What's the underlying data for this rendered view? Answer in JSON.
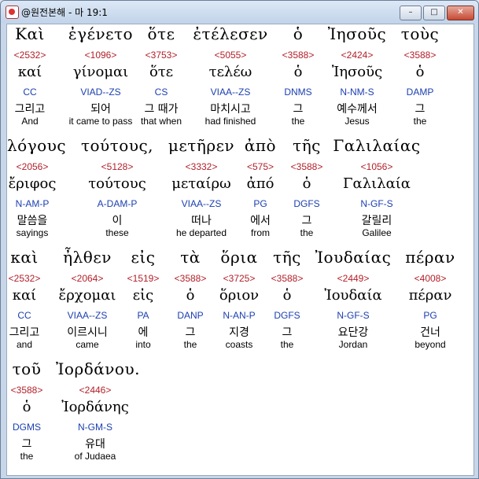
{
  "window": {
    "title": "@원전본해 - 마 19:1",
    "buttons": {
      "minimize": "–",
      "maximize": "□",
      "close": "✕"
    }
  },
  "rows": [
    [
      {
        "greek": "Καὶ",
        "strong": "<2532>",
        "lemma": "καί",
        "parse": "CC",
        "korean": "그리고",
        "english": "And"
      },
      {
        "greek": "ἐγένετο",
        "strong": "<1096>",
        "lemma": "γίνομαι",
        "parse": "VIAD--ZS",
        "korean": "되어",
        "english": "it came to pass"
      },
      {
        "greek": "ὅτε",
        "strong": "<3753>",
        "lemma": "ὅτε",
        "parse": "CS",
        "korean": "그 때가",
        "english": "that when"
      },
      {
        "greek": "ἐτέλεσεν",
        "strong": "<5055>",
        "lemma": "τελέω",
        "parse": "VIAA--ZS",
        "korean": "마치시고",
        "english": "had finished"
      },
      {
        "greek": "ὁ",
        "strong": "<3588>",
        "lemma": "ὁ",
        "parse": "DNMS",
        "korean": "그",
        "english": "the"
      },
      {
        "greek": "Ἰησοῦς",
        "strong": "<2424>",
        "lemma": "Ἰησοῦς",
        "parse": "N-NM-S",
        "korean": "예수께서",
        "english": "Jesus"
      },
      {
        "greek": "τοὺς",
        "strong": "<3588>",
        "lemma": "ὁ",
        "parse": "DAMP",
        "korean": "그",
        "english": "the"
      }
    ],
    [
      {
        "greek": "λόγους",
        "strong": "<2056>",
        "lemma": "ἔριφος",
        "parse": "N-AM-P",
        "korean": "말씀을",
        "english": "sayings"
      },
      {
        "greek": "τούτους,",
        "strong": "<5128>",
        "lemma": "τούτους",
        "parse": "A-DAM-P",
        "korean": "이",
        "english": "these"
      },
      {
        "greek": "μετῆρεν",
        "strong": "<3332>",
        "lemma": "μεταίρω",
        "parse": "VIAA--ZS",
        "korean": "떠나",
        "english": "he departed"
      },
      {
        "greek": "ἀπὸ",
        "strong": "<575>",
        "lemma": "ἀπό",
        "parse": "PG",
        "korean": "에서",
        "english": "from"
      },
      {
        "greek": "τῆς",
        "strong": "<3588>",
        "lemma": "ὁ",
        "parse": "DGFS",
        "korean": "그",
        "english": "the"
      },
      {
        "greek": "Γαλιλαίας",
        "strong": "<1056>",
        "lemma": "Γαλιλαία",
        "parse": "N-GF-S",
        "korean": "갈릴리",
        "english": "Galilee"
      }
    ],
    [
      {
        "greek": "καὶ",
        "strong": "<2532>",
        "lemma": "καί",
        "parse": "CC",
        "korean": "그리고",
        "english": "and"
      },
      {
        "greek": "ἦλθεν",
        "strong": "<2064>",
        "lemma": "ἔρχομαι",
        "parse": "VIAA--ZS",
        "korean": "이르시니",
        "english": "came"
      },
      {
        "greek": "εἰς",
        "strong": "<1519>",
        "lemma": "εἰς",
        "parse": "PA",
        "korean": "에",
        "english": "into"
      },
      {
        "greek": "τὰ",
        "strong": "<3588>",
        "lemma": "ὁ",
        "parse": "DANP",
        "korean": "그",
        "english": "the"
      },
      {
        "greek": "ὅρια",
        "strong": "<3725>",
        "lemma": "ὅριον",
        "parse": "N-AN-P",
        "korean": "지경",
        "english": "coasts"
      },
      {
        "greek": "τῆς",
        "strong": "<3588>",
        "lemma": "ὁ",
        "parse": "DGFS",
        "korean": "그",
        "english": "the"
      },
      {
        "greek": "Ἰουδαίας",
        "strong": "<2449>",
        "lemma": "Ἰουδαία",
        "parse": "N-GF-S",
        "korean": "요단강",
        "english": "Jordan"
      },
      {
        "greek": "πέραν",
        "strong": "<4008>",
        "lemma": "πέραν",
        "parse": "PG",
        "korean": "건너",
        "english": "beyond"
      }
    ],
    [
      {
        "greek": "τοῦ",
        "strong": "<3588>",
        "lemma": "ὁ",
        "parse": "DGMS",
        "korean": "그",
        "english": "the"
      },
      {
        "greek": "Ἰορδάνου.",
        "strong": "<2446>",
        "lemma": "Ἰορδάνης",
        "parse": "N-GM-S",
        "korean": "유대",
        "english": "of Judaea"
      }
    ]
  ]
}
